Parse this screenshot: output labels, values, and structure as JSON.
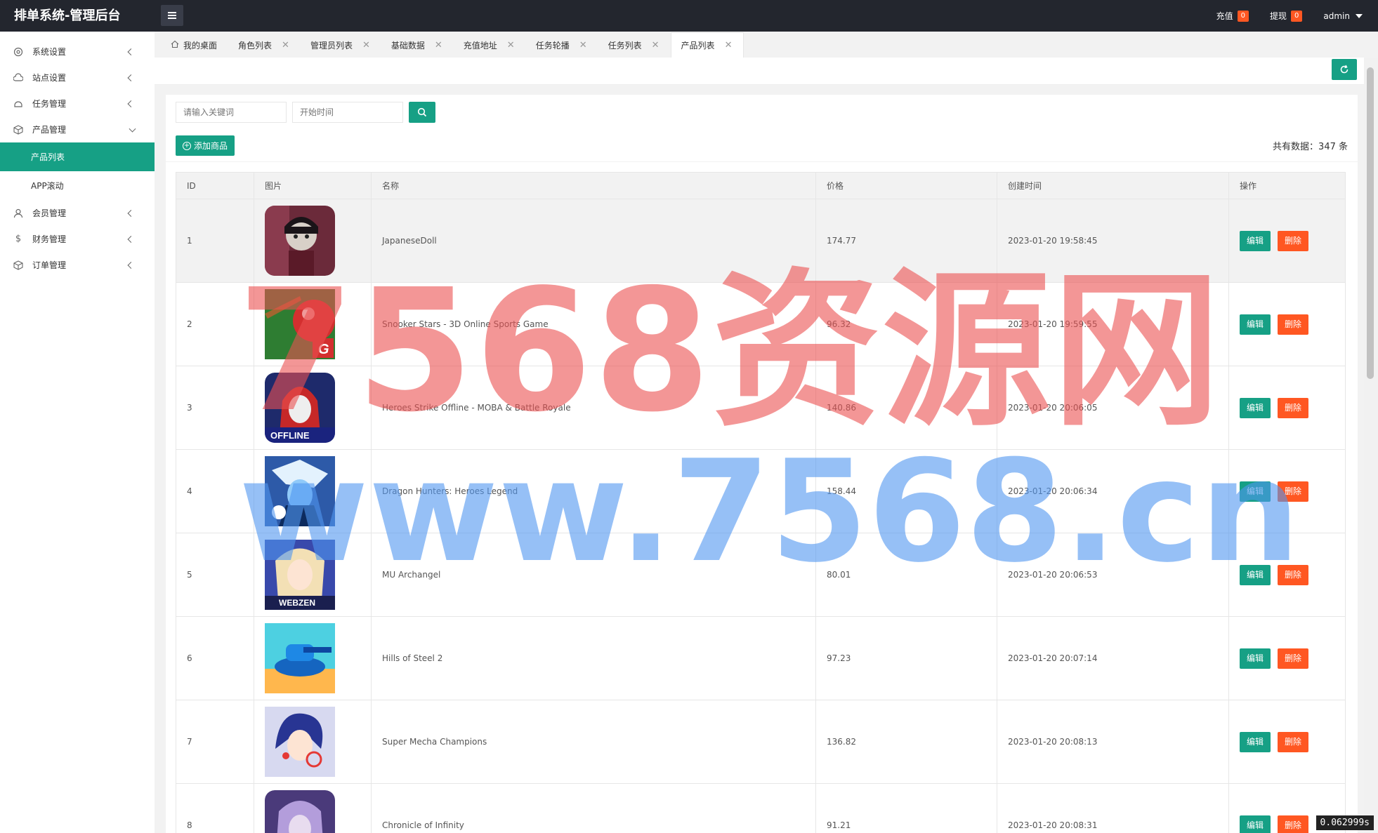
{
  "header": {
    "title": "排单系统-管理后台",
    "recharge_label": "充值",
    "recharge_count": "0",
    "withdraw_label": "提现",
    "withdraw_count": "0",
    "user": "admin"
  },
  "sidebar": {
    "items": [
      {
        "label": "系统设置",
        "icon": "gear-icon"
      },
      {
        "label": "站点设置",
        "icon": "cloud-icon"
      },
      {
        "label": "任务管理",
        "icon": "task-icon"
      },
      {
        "label": "产品管理",
        "icon": "cube-icon"
      },
      {
        "label": "会员管理",
        "icon": "user-icon"
      },
      {
        "label": "财务管理",
        "icon": "dollar-icon"
      },
      {
        "label": "订单管理",
        "icon": "box-icon"
      }
    ],
    "sub_items": [
      {
        "label": "产品列表",
        "active": true
      },
      {
        "label": "APP滚动",
        "active": false
      }
    ]
  },
  "tabs": [
    {
      "label": "我的桌面",
      "icon": "home-icon"
    },
    {
      "label": "角色列表"
    },
    {
      "label": "管理员列表"
    },
    {
      "label": "基础数据"
    },
    {
      "label": "充值地址"
    },
    {
      "label": "任务轮播"
    },
    {
      "label": "任务列表"
    },
    {
      "label": "产品列表",
      "active": true
    }
  ],
  "search": {
    "keyword_placeholder": "请输入关键词",
    "start_time_placeholder": "开始时间"
  },
  "add_button": "添加商品",
  "total_text": "共有数据：347 条",
  "table": {
    "headers": [
      "ID",
      "图片",
      "名称",
      "价格",
      "创建时间",
      "操作"
    ],
    "edit_label": "编辑",
    "delete_label": "删除",
    "rows": [
      {
        "id": "1",
        "name": "JapaneseDoll",
        "price": "174.77",
        "created": "2023-01-20 19:58:45"
      },
      {
        "id": "2",
        "name": "Snooker Stars - 3D Online Sports Game",
        "price": "96.32",
        "created": "2023-01-20 19:59:55"
      },
      {
        "id": "3",
        "name": "Heroes Strike Offline - MOBA & Battle Royale",
        "price": "140.86",
        "created": "2023-01-20 20:06:05"
      },
      {
        "id": "4",
        "name": "Dragon Hunters: Heroes Legend",
        "price": "158.44",
        "created": "2023-01-20 20:06:34"
      },
      {
        "id": "5",
        "name": "MU Archangel",
        "price": "80.01",
        "created": "2023-01-20 20:06:53"
      },
      {
        "id": "6",
        "name": "Hills of Steel 2",
        "price": "97.23",
        "created": "2023-01-20 20:07:14"
      },
      {
        "id": "7",
        "name": "Super Mecha Champions",
        "price": "136.82",
        "created": "2023-01-20 20:08:13"
      },
      {
        "id": "8",
        "name": "Chronicle of Infinity",
        "price": "91.21",
        "created": "2023-01-20 20:08:31"
      }
    ]
  },
  "icon_texts": {
    "offline": "OFFLINE",
    "webzen": "WEBZEN",
    "snooker_g": "G"
  },
  "watermark": {
    "line1": "7568资源网",
    "line2": "www.7568.cn"
  },
  "timer": "0.062999s",
  "colors": {
    "accent": "#16a085",
    "danger": "#ff5722",
    "header_bg": "#23262e"
  }
}
